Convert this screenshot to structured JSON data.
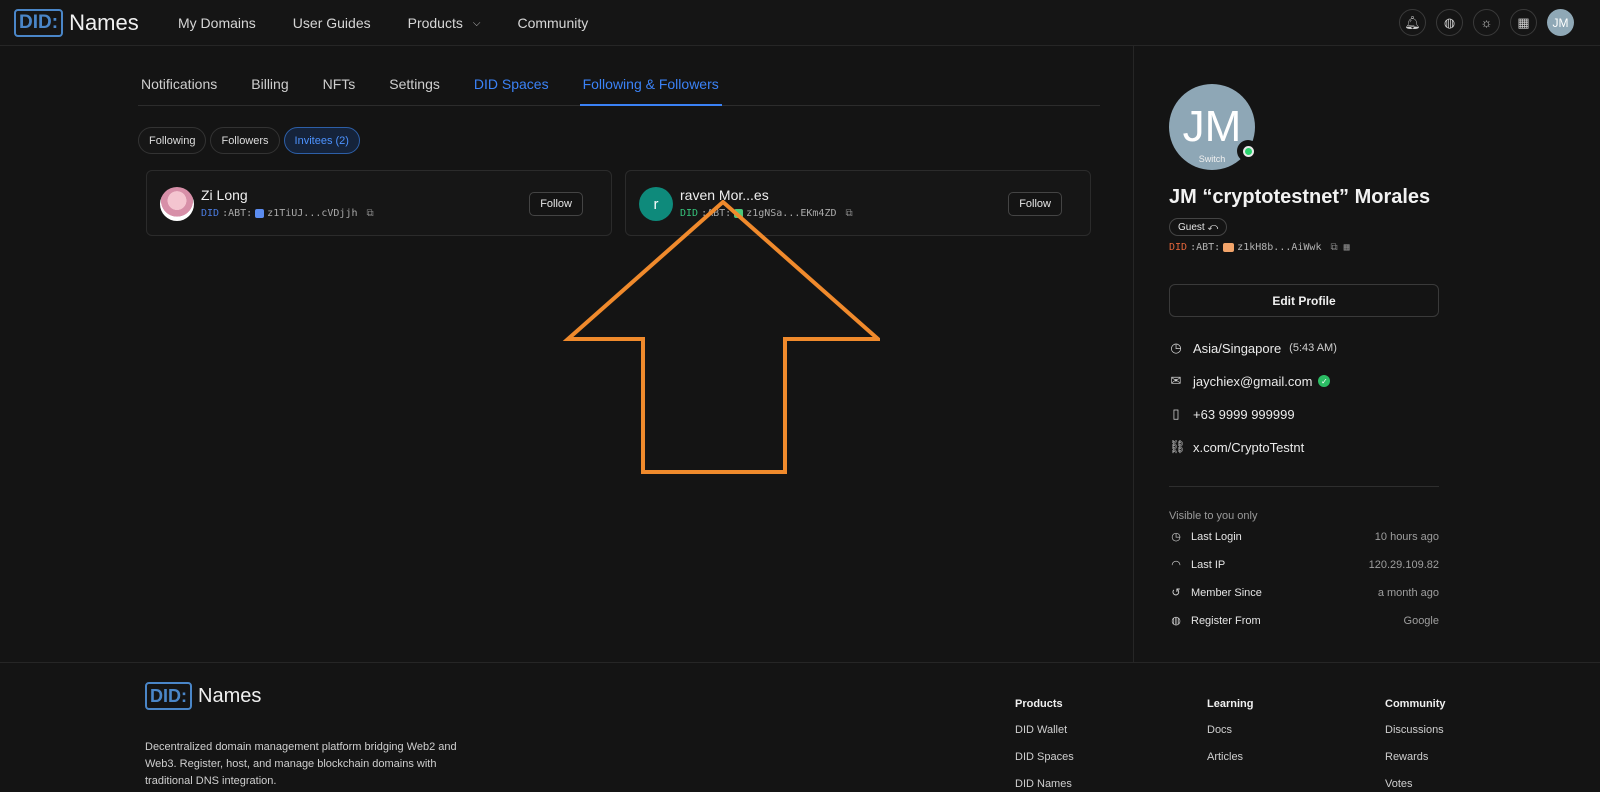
{
  "nav": {
    "logo_did": "DID",
    "logo_names": "Names",
    "links": [
      "My Domains",
      "User Guides",
      "Products",
      "Community"
    ],
    "avatar_initials": "JM"
  },
  "tabs": [
    "Notifications",
    "Billing",
    "NFTs",
    "Settings",
    "DID Spaces",
    "Following & Followers"
  ],
  "pills": [
    "Following",
    "Followers",
    "Invitees (2)"
  ],
  "invitees": [
    {
      "name": "Zi Long",
      "did_prefix": "DID",
      "did_mid": ":ABT:",
      "did_id": "z1TiUJ...cVDjjh",
      "follow": "Follow"
    },
    {
      "name": "raven Mor...es",
      "initial": "r",
      "did_prefix": "DID",
      "did_mid": ":ABT:",
      "did_id": "z1gNSa...EKm4ZD",
      "follow": "Follow"
    }
  ],
  "profile": {
    "initials": "JM",
    "switch_label": "Switch",
    "name": "JM “cryptotestnet” Morales",
    "role": "Guest ⤺",
    "did_prefix": "DID",
    "did_mid": ":ABT:",
    "did_id": "z1kH8b...AiWwk",
    "edit_label": "Edit Profile",
    "timezone": "Asia/Singapore",
    "local_time": "(5:43 AM)",
    "email": "jaychiex@gmail.com",
    "phone": "+63 9999 999999",
    "link": "x.com/CryptoTestnt",
    "visible_note": "Visible to you only",
    "stats": [
      {
        "label": "Last Login",
        "value": "10 hours ago"
      },
      {
        "label": "Last IP",
        "value": "120.29.109.82"
      },
      {
        "label": "Member Since",
        "value": "a month ago"
      },
      {
        "label": "Register From",
        "value": "Google"
      }
    ]
  },
  "footer": {
    "logo_did": "DID",
    "logo_names": "Names",
    "description": "Decentralized domain management platform bridging Web2 and Web3. Register, host, and manage blockchain domains with traditional DNS integration.",
    "columns": [
      {
        "title": "Products",
        "links": [
          "DID Wallet",
          "DID Spaces",
          "DID Names"
        ]
      },
      {
        "title": "Learning",
        "links": [
          "Docs",
          "Articles"
        ]
      },
      {
        "title": "Community",
        "links": [
          "Discussions",
          "Rewards",
          "Votes"
        ]
      }
    ]
  },
  "colors": {
    "accent": "#3b82f6",
    "arrow": "#f08a2c",
    "online": "#2bd56f"
  }
}
